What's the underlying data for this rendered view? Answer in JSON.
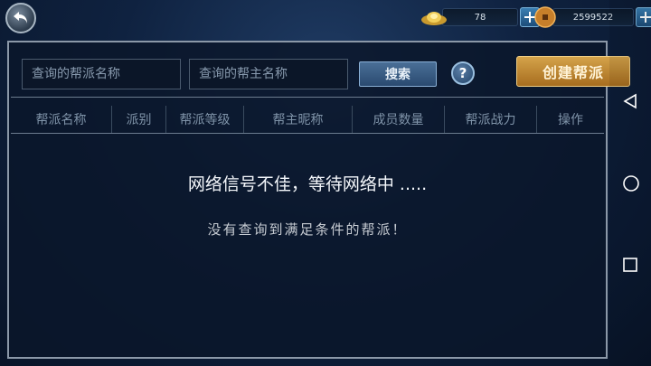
{
  "currency": {
    "gold_icon": "gold-ingot-icon",
    "gold_amount": "78",
    "coin_icon": "copper-coin-icon",
    "coin_amount": "2599522"
  },
  "search": {
    "guild_name_placeholder": "查询的帮派名称",
    "leader_name_placeholder": "查询的帮主名称",
    "search_label": "搜索",
    "help_label": "?",
    "create_label": "创建帮派"
  },
  "table": {
    "columns": [
      "帮派名称",
      "派别",
      "帮派等级",
      "帮主昵称",
      "成员数量",
      "帮派战力",
      "操作"
    ]
  },
  "messages": {
    "network": "网络信号不佳，等待网络中  .....",
    "empty": "没有查询到满足条件的帮派！"
  },
  "navbar": {
    "back": "triangle-back-icon",
    "home": "circle-home-icon",
    "recents": "square-recents-icon"
  }
}
